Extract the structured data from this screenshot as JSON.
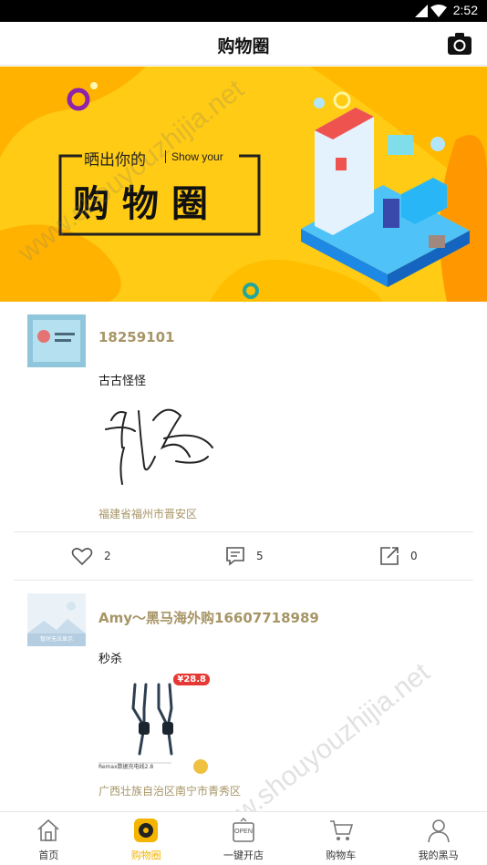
{
  "status_bar": {
    "time": "2:52"
  },
  "header": {
    "title": "购物圈"
  },
  "banner": {
    "title_small": "晒出你的",
    "title_small_en": "Show your",
    "title_big": "购物圈"
  },
  "posts": [
    {
      "username": "18259101",
      "content": "古古怪怪",
      "location": "福建省福州市晋安区",
      "likes": "2",
      "comments": "5",
      "shares": "0"
    },
    {
      "username": "Amy～黑马海外购16607718989",
      "content": "秒杀",
      "location": "广西壮族自治区南宁市青秀区",
      "image_price": "¥28.8",
      "image_caption": "Remax数据充电线2.8",
      "avatar_placeholder": "暂时无法显示"
    }
  ],
  "nav": [
    {
      "label": "首页",
      "icon": "home-icon"
    },
    {
      "label": "购物圈",
      "icon": "shopping-circle-icon"
    },
    {
      "label": "一键开店",
      "icon": "open-store-icon",
      "badge": "OPEN"
    },
    {
      "label": "购物车",
      "icon": "cart-icon"
    },
    {
      "label": "我的黑马",
      "icon": "profile-icon"
    }
  ],
  "watermark": "www.shouyouzhijia.net",
  "colors": {
    "accent": "#f4b400",
    "banner": "#ffcb14",
    "username": "#a79566"
  }
}
